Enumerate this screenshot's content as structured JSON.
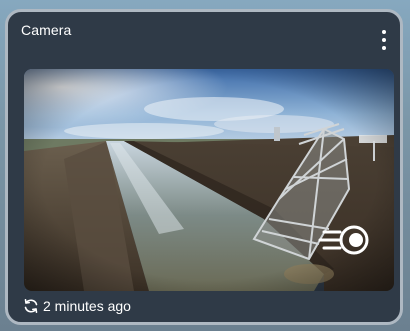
{
  "card": {
    "title": "Camera",
    "menu_icon": "more-vertical-icon"
  },
  "feed": {
    "speed_icon": "fast-forward-circle-icon"
  },
  "footer": {
    "refresh_icon": "refresh-icon",
    "updated_text": "2 minutes ago"
  },
  "colors": {
    "card_background": "#2f3a47",
    "card_border": "#aeb8c2",
    "text": "#ffffff"
  }
}
